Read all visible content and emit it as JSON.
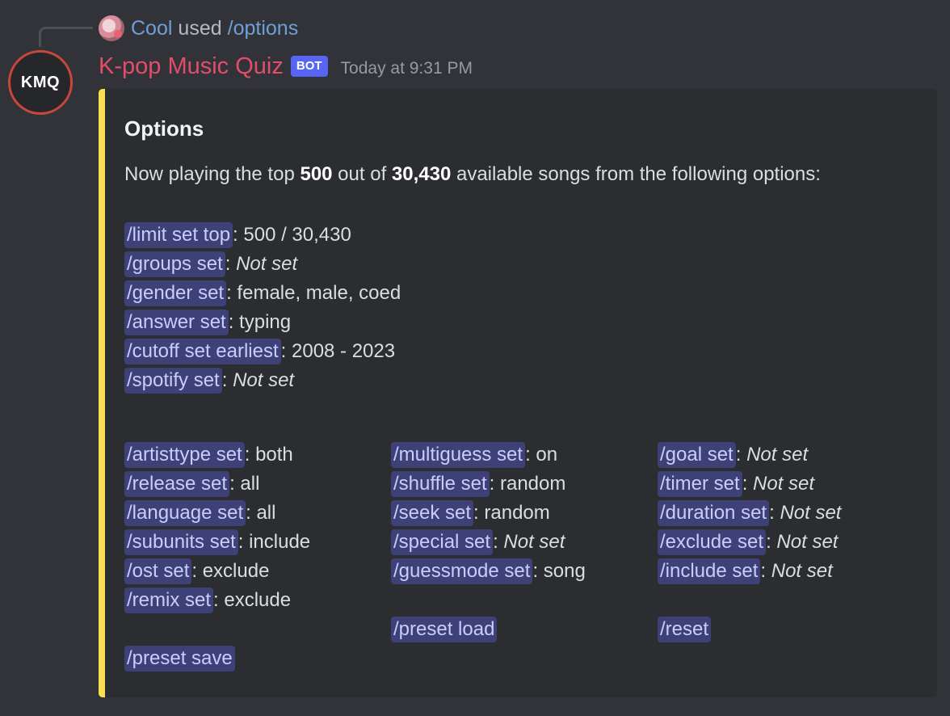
{
  "reply": {
    "user": "Cool",
    "word": "used",
    "command": "/options"
  },
  "avatar_text": "KMQ",
  "header": {
    "bot_name": "K-pop Music Quiz",
    "bot_tag": "BOT",
    "timestamp": "Today at 9:31 PM"
  },
  "embed": {
    "accent_color": "#f9e053",
    "title": "Options",
    "description": {
      "prefix": "Now playing the top ",
      "top": "500",
      "middle": " out of ",
      "total": "30,430",
      "suffix": " available songs from the following options:"
    },
    "main_options": [
      {
        "cmd": "/limit set top",
        "value": ": 500 / 30,430",
        "italic": false
      },
      {
        "cmd": "/groups set",
        "value": "Not set",
        "italic": true
      },
      {
        "cmd": "/gender set",
        "value": ": female, male, coed",
        "italic": false
      },
      {
        "cmd": "/answer set",
        "value": ": typing",
        "italic": false
      },
      {
        "cmd": "/cutoff set earliest",
        "value": ": 2008 - 2023",
        "italic": false
      },
      {
        "cmd": "/spotify set",
        "value": "Not set",
        "italic": true
      }
    ],
    "col1": [
      {
        "cmd": "/artisttype set",
        "value": ": both",
        "italic": false
      },
      {
        "cmd": "/release set",
        "value": ": all",
        "italic": false
      },
      {
        "cmd": "/language set",
        "value": ": all",
        "italic": false
      },
      {
        "cmd": "/subunits set",
        "value": ": include",
        "italic": false
      },
      {
        "cmd": "/ost set",
        "value": ": exclude",
        "italic": false
      },
      {
        "cmd": "/remix set",
        "value": ": exclude",
        "italic": false
      }
    ],
    "col2": [
      {
        "cmd": "/multiguess set",
        "value": ": on",
        "italic": false
      },
      {
        "cmd": "/shuffle set",
        "value": ": random",
        "italic": false
      },
      {
        "cmd": "/seek set",
        "value": ": random",
        "italic": false
      },
      {
        "cmd": "/special set",
        "value": "Not set",
        "italic": true
      },
      {
        "cmd": "/guessmode set",
        "value": ": song",
        "italic": false
      }
    ],
    "col3": [
      {
        "cmd": "/goal set",
        "value": "Not set",
        "italic": true
      },
      {
        "cmd": "/timer set",
        "value": "Not set",
        "italic": true
      },
      {
        "cmd": "/duration set",
        "value": "Not set",
        "italic": true
      },
      {
        "cmd": "/exclude set",
        "value": "Not set",
        "italic": true
      },
      {
        "cmd": "/include set",
        "value": "Not set",
        "italic": true
      }
    ],
    "preset_load": "/preset load",
    "reset": "/reset",
    "preset_save": "/preset save"
  }
}
